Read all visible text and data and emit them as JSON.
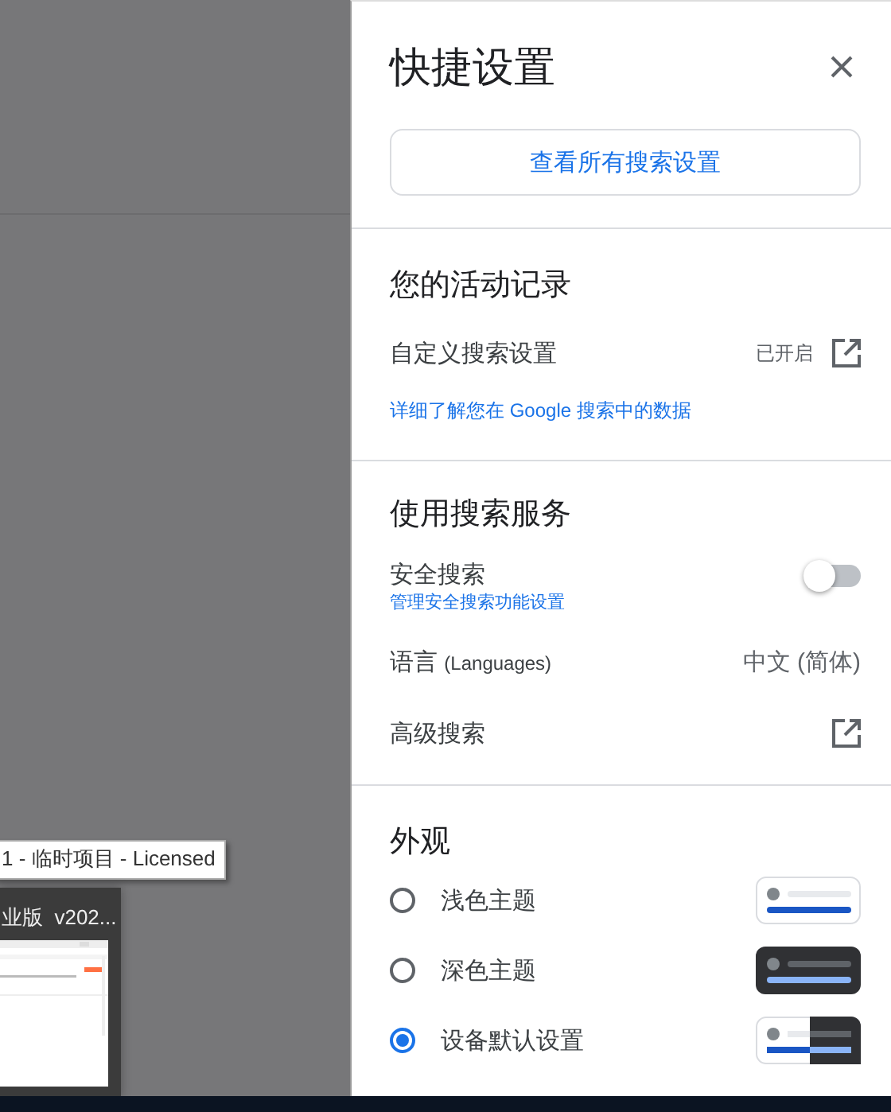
{
  "background": {
    "tooltip": "1 - 临时项目 - Licensed",
    "thumbnail": {
      "title": "业版  v202...",
      "kind": "picture"
    }
  },
  "panel": {
    "title": "快捷设置",
    "button": "查看所有搜索设置",
    "activity": {
      "heading": "您的活动记录",
      "row": {
        "label": "自定义搜索设置",
        "status": "已开启"
      },
      "link": "详细了解您在 Google 搜索中的数据"
    },
    "services": {
      "heading": "使用搜索服务",
      "safe_search": {
        "label": "安全搜索",
        "link": "管理安全搜索功能设置",
        "on": false
      },
      "language": {
        "label": "语言",
        "note": "(Languages)",
        "value": "中文 (简体)"
      },
      "advanced": {
        "label": "高级搜索"
      }
    },
    "appearance": {
      "heading": "外观",
      "options": [
        {
          "label": "浅色主题",
          "kind": "light",
          "selected": false
        },
        {
          "label": "深色主题",
          "kind": "dark",
          "selected": false
        },
        {
          "label": "设备默认设置",
          "kind": "system",
          "selected": true
        }
      ]
    }
  }
}
